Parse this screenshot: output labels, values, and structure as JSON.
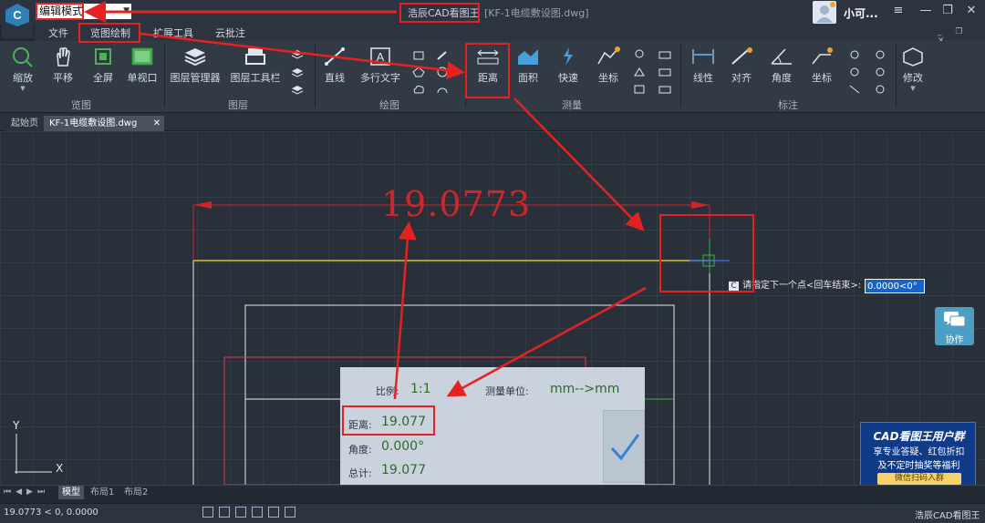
{
  "titlebar": {
    "mode_select": "编辑模式",
    "app_title": "浩辰CAD看图王",
    "doc_title": "[KF-1电缆敷设图.dwg]",
    "user_name": "小可..."
  },
  "menubar": {
    "items": [
      "文件",
      "览图绘制",
      "扩展工具",
      "云批注"
    ]
  },
  "ribbon": {
    "tools": {
      "zoom": "缩放",
      "pan": "平移",
      "fullscreen": "全屏",
      "single_viewport": "单视口",
      "layer_manager": "图层管理器",
      "layer_toolbar": "图层工具栏",
      "line": "直线",
      "mtext": "多行文字",
      "distance": "距离",
      "area": "面积",
      "quick": "快速",
      "coordinate": "坐标",
      "linear": "线性",
      "aligned": "对齐",
      "angle": "角度",
      "coordinate_dim": "坐标",
      "modify": "修改"
    },
    "panels": {
      "browse": "览图",
      "layer": "图层",
      "draw": "绘图",
      "measure": "测量",
      "annotate": "标注"
    }
  },
  "tabs": {
    "start": "起始页",
    "document": "KF-1电缆敷设图.dwg"
  },
  "canvas": {
    "dimension_text": "19.0773",
    "command_prompt": "请指定下一个点<回车结束>:",
    "command_icon": "C",
    "command_value": "0.0000<0°",
    "ucs_x": "X",
    "ucs_y": "Y"
  },
  "collab": {
    "label": "协作"
  },
  "measure_panel": {
    "scale_label": "比例:",
    "scale_value": "1:1",
    "unit_label": "测量单位:",
    "unit_value": "mm-->mm",
    "distance_label": "距离:",
    "distance_value": "19.077",
    "angle_label": "角度:",
    "angle_value": "0.000°",
    "total_label": "总计:",
    "total_value": "19.077"
  },
  "ad": {
    "title": "CAD看图王用户群",
    "line1": "享专业答疑、红包折扣",
    "line2": "及不定时抽奖等福利",
    "cta": "微信扫码入群"
  },
  "layout_tabs": [
    "模型",
    "布局1",
    "布局2"
  ],
  "statusbar": {
    "coords": "19.0773 < 0, 0.0000",
    "app_name": "浩辰CAD看图王"
  },
  "colors": {
    "annotation_red": "#e52222",
    "dimension_red": "#d0262b",
    "accent_blue": "#1664c8"
  }
}
